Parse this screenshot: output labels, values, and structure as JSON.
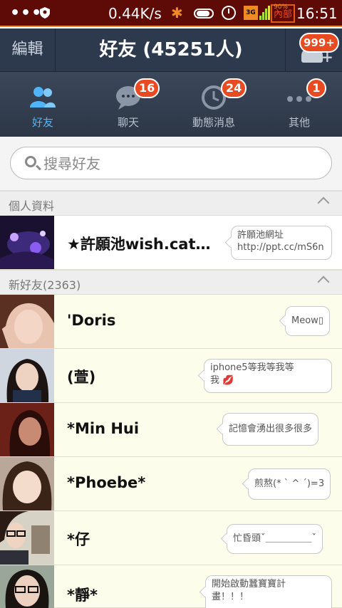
{
  "status_bar": {
    "dots": "•••",
    "net_speed": "0.44K/s",
    "battery_label": "內部",
    "battery_pct": "90%",
    "time": "16:51"
  },
  "header": {
    "edit_label": "編輯",
    "title": "好友 (45251人)",
    "add_badge": "999+"
  },
  "tabs": [
    {
      "label": "好友",
      "badge": "",
      "icon": "friends-icon",
      "active": true
    },
    {
      "label": "聊天",
      "badge": "16",
      "icon": "chat-icon",
      "active": false
    },
    {
      "label": "動態消息",
      "badge": "24",
      "icon": "clock-icon",
      "active": false
    },
    {
      "label": "其他",
      "badge": "1",
      "icon": "more-icon",
      "active": false
    }
  ],
  "search": {
    "placeholder": "搜尋好友"
  },
  "sections": {
    "profile": {
      "title": "個人資料"
    },
    "new_friends": {
      "title": "新好友",
      "count": "(2363)"
    }
  },
  "profile": {
    "name": "★許願池wish.cat…",
    "status": [
      "許願池網址",
      "http://ppt.cc/mS6n"
    ]
  },
  "friends": [
    {
      "name": "'Doris",
      "status": [
        "Meow▯"
      ]
    },
    {
      "name": "(萱)",
      "status": [
        "iphone5等我等我等",
        "我 💋"
      ]
    },
    {
      "name": "*Min Hui",
      "status": [
        "記憶會湧出很多很多"
      ]
    },
    {
      "name": "*Phoebe*",
      "status": [
        "煎熬(* ˋ ^ ˊ)=3"
      ]
    },
    {
      "name": "*仔",
      "status": [
        "忙昏頭ˇ＿＿＿＿＿ˇ"
      ]
    },
    {
      "name": "*靜*",
      "status": [
        "開始啟動蠶寶寶計",
        "畫！！！"
      ]
    }
  ]
}
